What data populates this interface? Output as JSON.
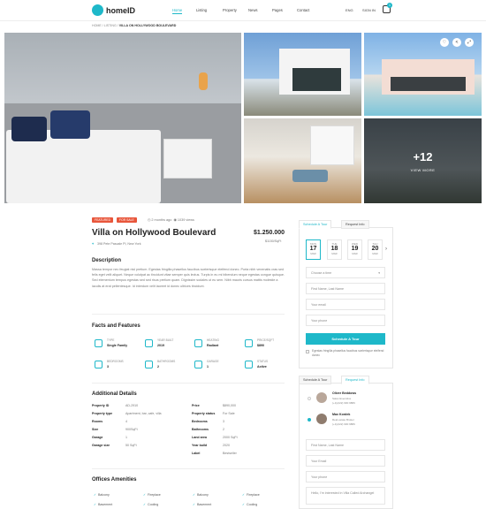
{
  "header": {
    "logo": "homeID",
    "nav": [
      "Home",
      "Listing",
      "Property",
      "News",
      "Pages",
      "Contact"
    ],
    "lang": "ENG",
    "signin": "SIGN IN",
    "cart_count": "1"
  },
  "breadcrumb": {
    "a": "HOME",
    "b": "LISTING",
    "current": "VILLA ON HOLLYWOOD BOULEVARD"
  },
  "gallery": {
    "more_count": "+12",
    "more_label": "VIEW MORE"
  },
  "listing": {
    "tag_featured": "FEATURED",
    "tag_sale": "FOR SALE",
    "time": "2 months ago",
    "views": "1039 views",
    "title": "Villa on Hollywood Boulevard",
    "price": "$1.250.000",
    "price_sqft": "$1150/SqFt",
    "address": "398 Pete Pascale Pl, New York"
  },
  "description": {
    "heading": "Description",
    "text": "Massa tempor nec feugiat nisl pretium. Egestas fringilla phasellus faucibus scelerisque eleifend donec. Porta nibh venenatis cras sed felis eget velit aliquet. Neque volutpat ac tincidunt vitae semper quis lectus. Turpis in eu mi bibendum neque egestas congue quisque. Sed elementum tempus egestas sed sed risus pretium quam. Dignissim sodales ut eu sem. Nibh mauris cursus mattis molestie a iaculis at erat pellentesque. Id interdum velit laoreet id donec ultrices tincidunt."
  },
  "facts": {
    "heading": "Facts and Features",
    "items": [
      {
        "label": "TYPE",
        "value": "Single Family"
      },
      {
        "label": "YEAR BUILT",
        "value": "2019"
      },
      {
        "label": "HEATING",
        "value": "Radiant"
      },
      {
        "label": "PRICE/SQFT",
        "value": "$890"
      },
      {
        "label": "BEDROOMS",
        "value": "3"
      },
      {
        "label": "BATHROOMS",
        "value": "2"
      },
      {
        "label": "GARAGE",
        "value": "1"
      },
      {
        "label": "STATUS",
        "value": "Active"
      }
    ]
  },
  "details": {
    "heading": "Additional Details",
    "rows": [
      [
        "Property ID",
        "AD-2910",
        "Price",
        "$890,000"
      ],
      [
        "Property type",
        "Apartment, bar, cafe, villa",
        "Property status",
        "For Sale"
      ],
      [
        "Rooms",
        "4",
        "Bedrooms",
        "3"
      ],
      [
        "Size",
        "900SqFt",
        "Bathrooms",
        "2"
      ],
      [
        "Garage",
        "1",
        "Land area",
        "2000 SqFt"
      ],
      [
        "Garage size",
        "50 SqFt",
        "Year build",
        "2020"
      ],
      [
        "",
        "",
        "Label",
        "Bestseller"
      ]
    ]
  },
  "amenities": {
    "heading": "Offices Amenities",
    "items": [
      "Balcony",
      "Fireplace",
      "Balcony",
      "Fireplace",
      "Basement",
      "Cooling",
      "Basement",
      "Cooling"
    ]
  },
  "tour": {
    "tab1": "Schedule A Tour",
    "tab2": "Request Info",
    "days": [
      {
        "d": "17",
        "n": "MON",
        "m": "MAR"
      },
      {
        "d": "18",
        "n": "TUE",
        "m": "MAR"
      },
      {
        "d": "19",
        "n": "WED",
        "m": "MAR"
      },
      {
        "d": "20",
        "n": "THU",
        "m": "MAR"
      }
    ],
    "time_placeholder": "Choose a time",
    "name": "First Name, Last Name",
    "email": "Your email",
    "phone": "Your phone",
    "button": "Schedule A Tour",
    "consent": "Egestas fringilla phasellus faucibus scelerisque eleifend donec"
  },
  "request": {
    "tab1": "Schedule A Tour",
    "tab2": "Request Info",
    "agents": [
      {
        "name": "Oliver Beddows",
        "role": "Sales Executive",
        "phone": "(+1)(222) 900 9889"
      },
      {
        "name": "Max Kordek",
        "role": "Real estate Broker",
        "phone": "(+1)(222) 900 9889"
      }
    ],
    "name": "First Name, Last Name",
    "email": "Your Email",
    "phone": "Your phone",
    "message": "Hello, I'm interested in Villa Called Archangel"
  },
  "colors": {
    "accent": "#1eb8c9",
    "tag_featured": "#e8563b",
    "tag_sale": "#e8563b"
  }
}
